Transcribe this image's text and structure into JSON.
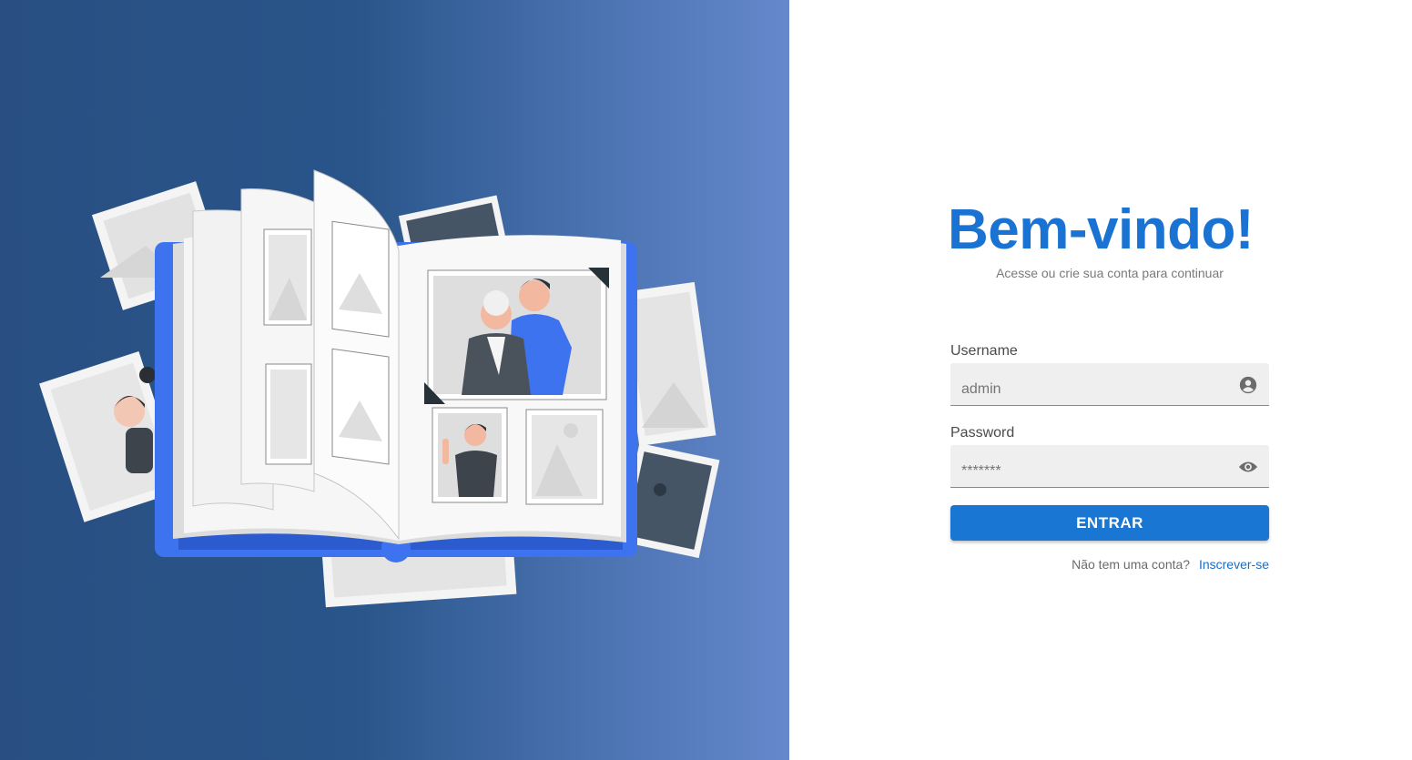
{
  "hero": {
    "illustration": "open-photo-album-illustration"
  },
  "login": {
    "title": "Bem-vindo!",
    "subtitle": "Acesse ou crie sua conta para continuar",
    "username": {
      "label": "Username",
      "placeholder": "admin",
      "value": "",
      "icon": "account-circle-icon"
    },
    "password": {
      "label": "Password",
      "placeholder": "*******",
      "value": "",
      "icon": "eye-icon"
    },
    "submit_label": "ENTRAR",
    "signup_prompt": "Não tem uma conta?",
    "signup_link": "Inscrever-se"
  },
  "colors": {
    "accent": "#1976d2",
    "title": "#1a73d2",
    "panel_gradient_start": "#294f82",
    "panel_gradient_end": "#6588cc"
  }
}
